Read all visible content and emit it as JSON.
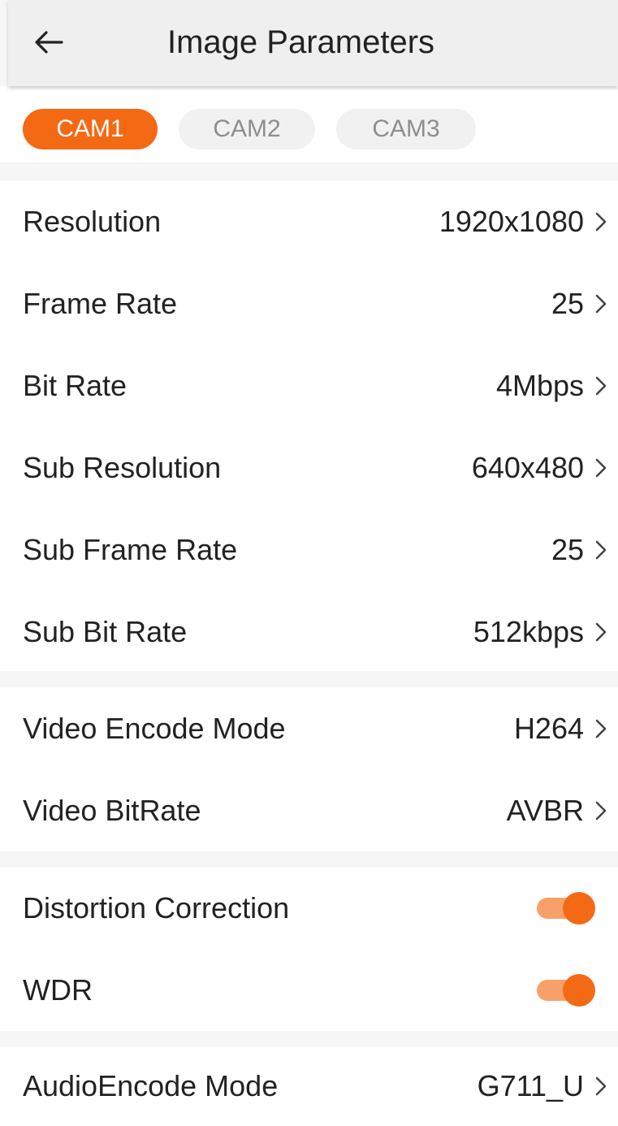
{
  "header": {
    "title": "Image Parameters",
    "back_icon": "arrow-left-icon"
  },
  "tabs": [
    {
      "label": "CAM1",
      "active": true
    },
    {
      "label": "CAM2",
      "active": false
    },
    {
      "label": "CAM3",
      "active": false
    }
  ],
  "stream_settings": [
    {
      "label": "Resolution",
      "value": "1920x1080"
    },
    {
      "label": "Frame Rate",
      "value": "25"
    },
    {
      "label": "Bit Rate",
      "value": "4Mbps"
    },
    {
      "label": "Sub Resolution",
      "value": "640x480"
    },
    {
      "label": "Sub Frame Rate",
      "value": "25"
    },
    {
      "label": "Sub Bit Rate",
      "value": "512kbps"
    }
  ],
  "encode_settings": [
    {
      "label": "Video Encode Mode",
      "value": "H264"
    },
    {
      "label": "Video BitRate",
      "value": "AVBR"
    }
  ],
  "toggles": [
    {
      "label": "Distortion Correction",
      "on": true
    },
    {
      "label": "WDR",
      "on": true
    }
  ],
  "audio_settings": [
    {
      "label": "AudioEncode Mode",
      "value": "G711_U"
    }
  ],
  "colors": {
    "accent": "#f46a14",
    "accent_light": "#f7a06a",
    "page_bg": "#f6f6f6"
  }
}
